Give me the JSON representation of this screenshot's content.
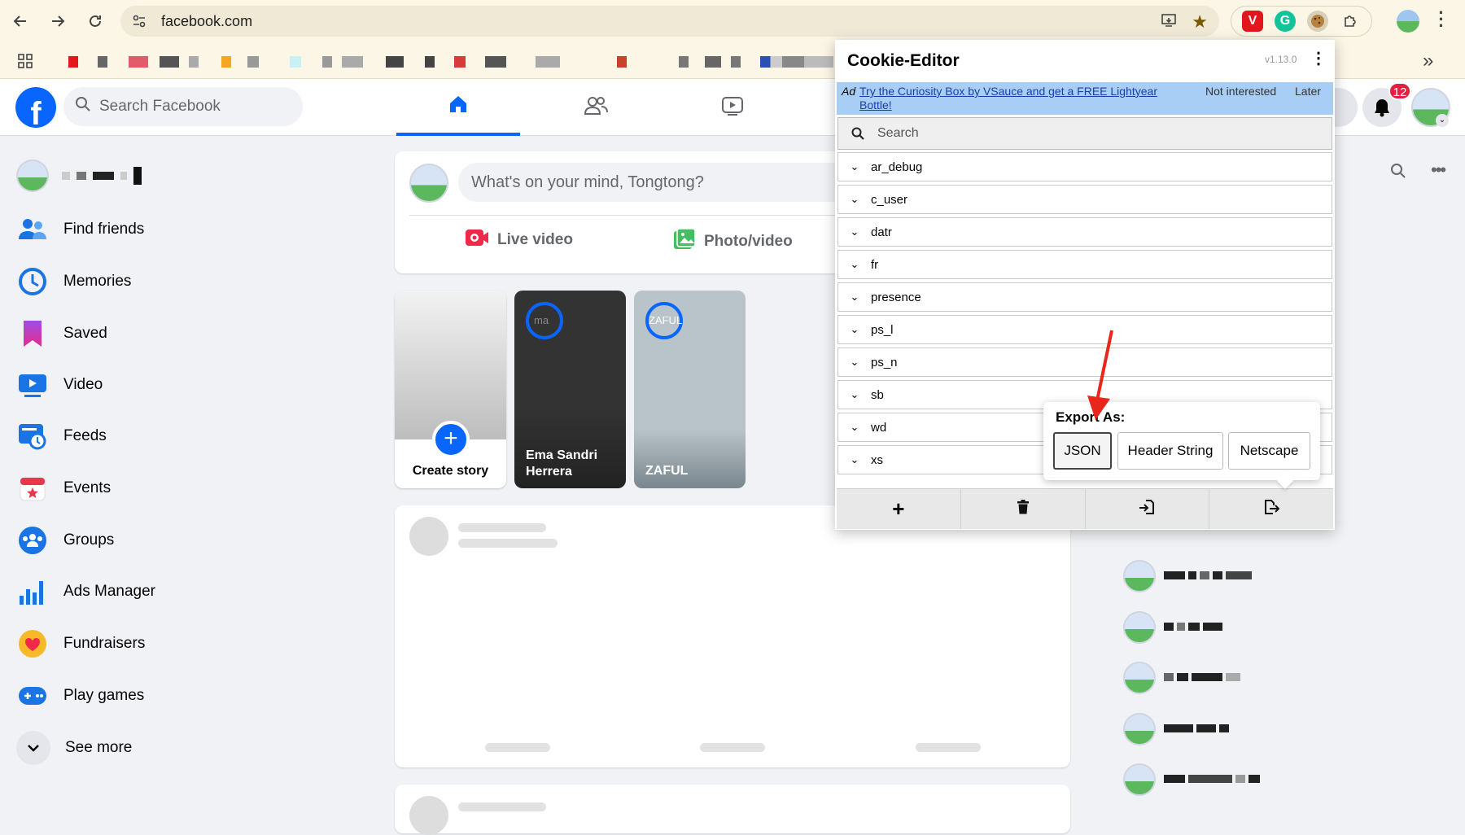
{
  "browser": {
    "url": "facebook.com",
    "icons": [
      "back-icon",
      "forward-icon",
      "reload-icon",
      "site-info-icon",
      "install-app-icon",
      "bookmark-star-icon",
      "vivaldi-ext-icon",
      "grammarly-icon",
      "cookie-editor-ext-icon",
      "extensions-puzzle-icon",
      "profile-avatar-icon",
      "chrome-menu-icon"
    ],
    "bookmarks_overflow": "»"
  },
  "facebook": {
    "search_placeholder": "Search Facebook",
    "notifications_count": "12",
    "composer_placeholder": "What's on your mind, Tongtong?",
    "live_video": "Live video",
    "photo_video": "Photo/video",
    "stories": [
      {
        "label": "Create story"
      },
      {
        "label": "Ema Sandri Herrera",
        "thumb_text": "ma"
      },
      {
        "label": "ZAFUL",
        "thumb_text": "ZAFUL"
      }
    ],
    "sidebar": [
      {
        "label": "Find friends",
        "icon": "friends-icon"
      },
      {
        "label": "Memories",
        "icon": "memories-clock-icon"
      },
      {
        "label": "Saved",
        "icon": "saved-bookmark-icon"
      },
      {
        "label": "Video",
        "icon": "video-icon"
      },
      {
        "label": "Feeds",
        "icon": "feeds-icon"
      },
      {
        "label": "Events",
        "icon": "events-calendar-icon"
      },
      {
        "label": "Groups",
        "icon": "groups-icon"
      },
      {
        "label": "Ads Manager",
        "icon": "ads-manager-chart-icon"
      },
      {
        "label": "Fundraisers",
        "icon": "fundraisers-heart-icon"
      },
      {
        "label": "Play games",
        "icon": "games-controller-icon"
      },
      {
        "label": "See more",
        "icon": "chevron-down-icon"
      }
    ],
    "colors": {
      "brand": "#0866ff",
      "badge": "#e41e3f"
    }
  },
  "cookie_editor": {
    "title": "Cookie-Editor",
    "version": "v1.13.0",
    "ad": {
      "tag": "Ad",
      "text": "Try the Curiosity Box by VSauce and get a FREE Lightyear Bottle!",
      "not_interested": "Not interested",
      "later": "Later"
    },
    "search_placeholder": "Search",
    "cookies": [
      "ar_debug",
      "c_user",
      "datr",
      "fr",
      "presence",
      "ps_l",
      "ps_n",
      "sb",
      "wd",
      "xs"
    ],
    "export": {
      "label": "Export As:",
      "options": [
        "JSON",
        "Header String",
        "Netscape"
      ]
    },
    "bottom_buttons": [
      "add-icon",
      "delete-trash-icon",
      "import-icon",
      "export-icon"
    ]
  }
}
